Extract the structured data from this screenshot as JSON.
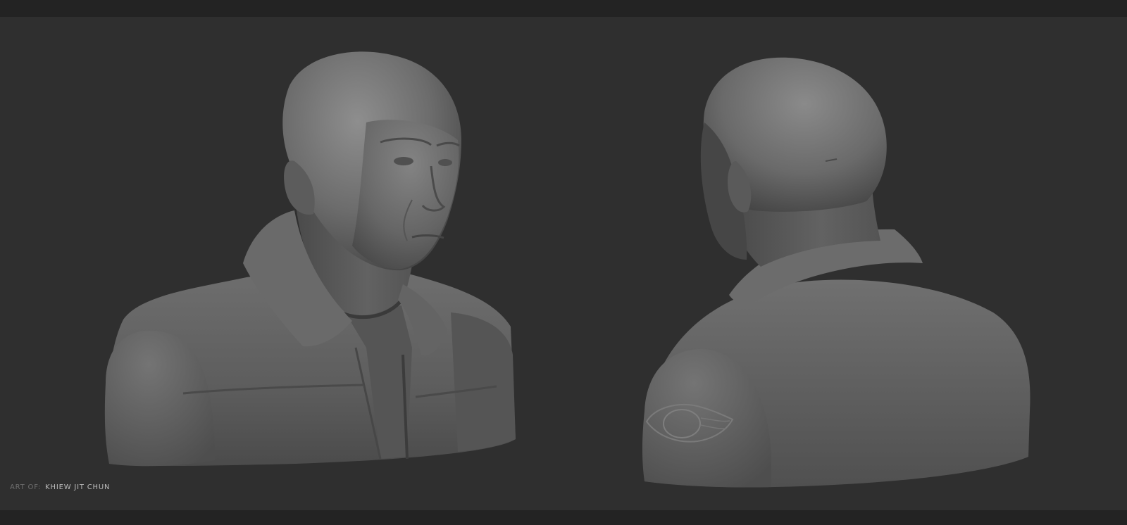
{
  "image": {
    "subject": "two grayscale 3D sculpt renders of a bald man's bust wearing a fleece jacket, front three-quarter and rear three-quarter views",
    "colors": {
      "page_band": "#232323",
      "canvas_background": "#2f2f2f",
      "clay_light": "#8a8a8a",
      "clay_mid": "#626262",
      "clay_dark": "#3e3e3e"
    }
  },
  "credit": {
    "prefix": "ART OF:",
    "name": "KHIEW JIT CHUN"
  }
}
